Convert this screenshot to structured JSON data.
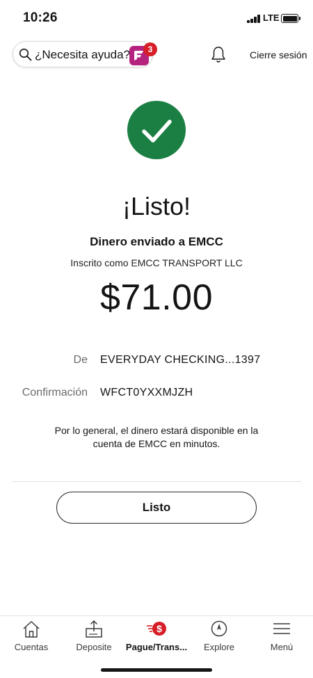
{
  "status_bar": {
    "time": "10:26",
    "network": "LTE",
    "battery_level": 1.0
  },
  "header": {
    "help_text": "¿Necesita ayuda?",
    "notification_count": "3",
    "sign_out_label": "Cierre sesión"
  },
  "confirmation": {
    "title": "¡Listo!",
    "subtitle": "Dinero enviado a EMCC",
    "enrolled_as": "Inscrito como EMCC TRANSPORT LLC",
    "amount": "$71.00",
    "from_label": "De",
    "from_value": "EVERYDAY CHECKING...1397",
    "confirmation_label": "Confirmación",
    "confirmation_value": "WFCT0YXXMJZH",
    "note": "Por lo general, el dinero estará disponible en la cuenta de EMCC en minutos."
  },
  "done_button_label": "Listo",
  "bottom_nav": {
    "items": [
      {
        "label": "Cuentas",
        "icon": "home-icon"
      },
      {
        "label": "Deposite",
        "icon": "deposit-icon"
      },
      {
        "label": "Pague/Trans...",
        "icon": "pay-transfer-icon",
        "active": true
      },
      {
        "label": "Explore",
        "icon": "compass-icon"
      },
      {
        "label": "Menú",
        "icon": "menu-icon"
      }
    ]
  },
  "colors": {
    "success": "#1b7f43",
    "badge": "#d71e28",
    "brand_icon": "#b5237f"
  }
}
